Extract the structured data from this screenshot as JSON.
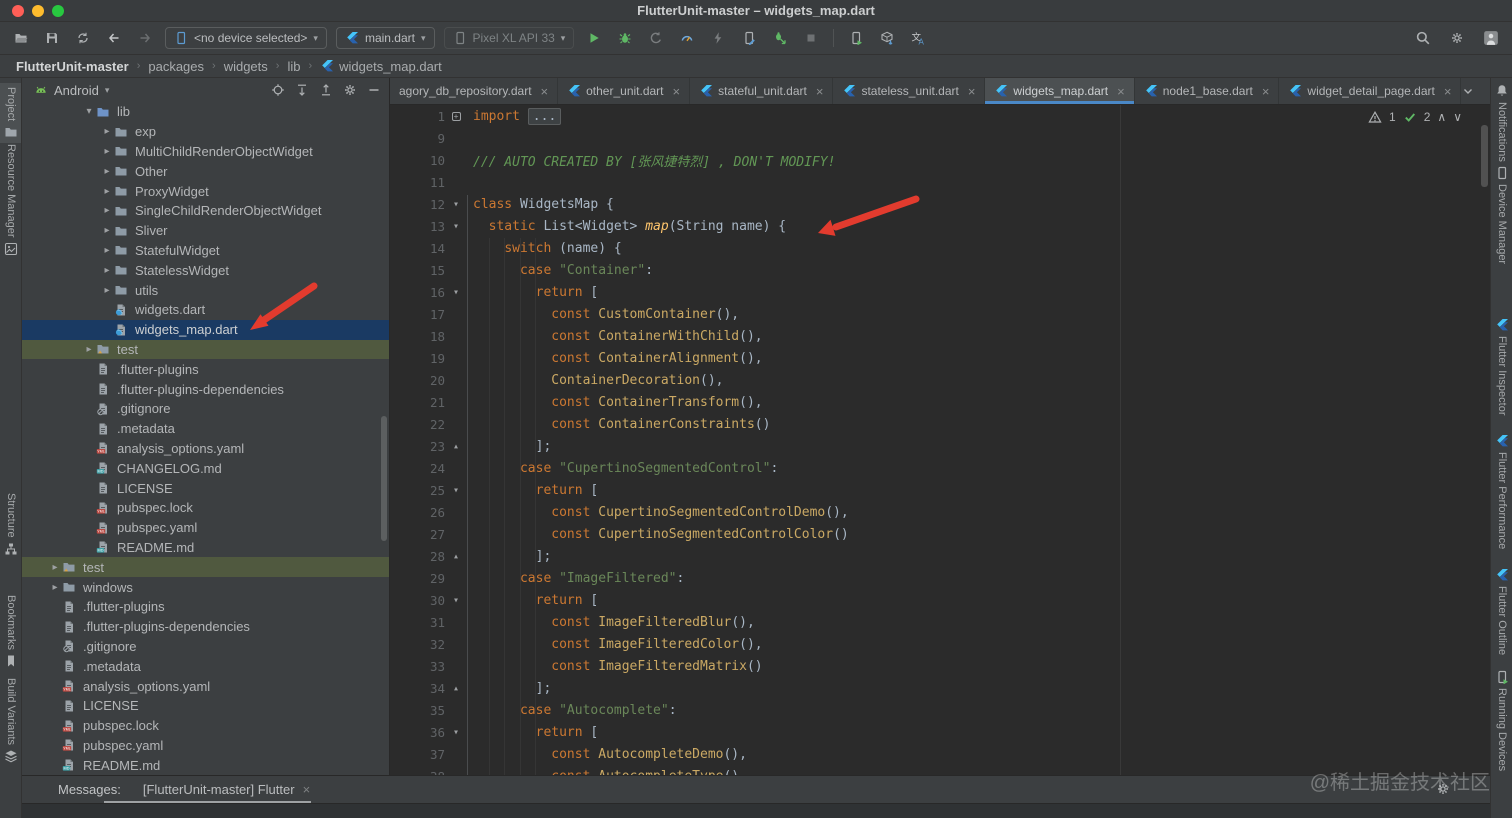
{
  "window": {
    "title": "FlutterUnit-master – widgets_map.dart"
  },
  "toolbar": {
    "device_selector": "<no device selected>",
    "run_config": "main.dart",
    "target_device": "Pixel XL API 33"
  },
  "breadcrumbs": {
    "items": [
      "FlutterUnit-master",
      "packages",
      "widgets",
      "lib",
      "widgets_map.dart"
    ]
  },
  "left_strip": {
    "items": [
      {
        "label": "Project",
        "icon": "project-folder",
        "active": true
      },
      {
        "label": "Resource Manager",
        "icon": "resource-manager",
        "active": false
      },
      {
        "label": "Structure",
        "icon": "structure",
        "active": false
      },
      {
        "label": "Bookmarks",
        "icon": "bookmarks",
        "active": false
      },
      {
        "label": "Build Variants",
        "icon": "build-variants",
        "active": false
      }
    ]
  },
  "right_strip": {
    "items": [
      {
        "label": "Notifications",
        "icon": "bell"
      },
      {
        "label": "Device Manager",
        "icon": "device"
      },
      {
        "label": "Flutter Inspector",
        "icon": "flutter"
      },
      {
        "label": "Flutter Performance",
        "icon": "flutter"
      },
      {
        "label": "Flutter Outline",
        "icon": "flutter"
      },
      {
        "label": "Running Devices",
        "icon": "device-play"
      }
    ]
  },
  "project_panel": {
    "view_mode": "Android",
    "tree": [
      {
        "label": "lib",
        "icon": "folder-lib",
        "level": 1,
        "chevron": "expanded"
      },
      {
        "label": "exp",
        "icon": "folder",
        "level": 2,
        "chevron": "collapsed"
      },
      {
        "label": "MultiChildRenderObjectWidget",
        "icon": "folder",
        "level": 2,
        "chevron": "collapsed"
      },
      {
        "label": "Other",
        "icon": "folder",
        "level": 2,
        "chevron": "collapsed"
      },
      {
        "label": "ProxyWidget",
        "icon": "folder",
        "level": 2,
        "chevron": "collapsed"
      },
      {
        "label": "SingleChildRenderObjectWidget",
        "icon": "folder",
        "level": 2,
        "chevron": "collapsed"
      },
      {
        "label": "Sliver",
        "icon": "folder",
        "level": 2,
        "chevron": "collapsed"
      },
      {
        "label": "StatefulWidget",
        "icon": "folder",
        "level": 2,
        "chevron": "collapsed"
      },
      {
        "label": "StatelessWidget",
        "icon": "folder",
        "level": 2,
        "chevron": "collapsed"
      },
      {
        "label": "utils",
        "icon": "folder",
        "level": 2,
        "chevron": "collapsed"
      },
      {
        "label": "widgets.dart",
        "icon": "dart-file",
        "level": 2,
        "chevron": "none"
      },
      {
        "label": "widgets_map.dart",
        "icon": "dart-file",
        "level": 2,
        "chevron": "none",
        "selected": true
      },
      {
        "label": "test",
        "icon": "folder-test",
        "level": 1,
        "chevron": "collapsed",
        "highlight": "green"
      },
      {
        "label": ".flutter-plugins",
        "icon": "file",
        "level": 1,
        "chevron": "none"
      },
      {
        "label": ".flutter-plugins-dependencies",
        "icon": "file",
        "level": 1,
        "chevron": "none"
      },
      {
        "label": ".gitignore",
        "icon": "git-file",
        "level": 1,
        "chevron": "none"
      },
      {
        "label": ".metadata",
        "icon": "file",
        "level": 1,
        "chevron": "none"
      },
      {
        "label": "analysis_options.yaml",
        "icon": "yaml-file",
        "level": 1,
        "chevron": "none"
      },
      {
        "label": "CHANGELOG.md",
        "icon": "md-file",
        "level": 1,
        "chevron": "none"
      },
      {
        "label": "LICENSE",
        "icon": "file",
        "level": 1,
        "chevron": "none"
      },
      {
        "label": "pubspec.lock",
        "icon": "yaml-file",
        "level": 1,
        "chevron": "none"
      },
      {
        "label": "pubspec.yaml",
        "icon": "yaml-file",
        "level": 1,
        "chevron": "none"
      },
      {
        "label": "README.md",
        "icon": "md-file",
        "level": 1,
        "chevron": "none"
      },
      {
        "label": "test",
        "icon": "folder-test",
        "level": 0,
        "chevron": "collapsed",
        "highlight": "green"
      },
      {
        "label": "windows",
        "icon": "folder",
        "level": 0,
        "chevron": "collapsed"
      },
      {
        "label": ".flutter-plugins",
        "icon": "file",
        "level": 0,
        "chevron": "none"
      },
      {
        "label": ".flutter-plugins-dependencies",
        "icon": "file",
        "level": 0,
        "chevron": "none"
      },
      {
        "label": ".gitignore",
        "icon": "git-file",
        "level": 0,
        "chevron": "none"
      },
      {
        "label": ".metadata",
        "icon": "file",
        "level": 0,
        "chevron": "none"
      },
      {
        "label": "analysis_options.yaml",
        "icon": "yaml-file",
        "level": 0,
        "chevron": "none"
      },
      {
        "label": "LICENSE",
        "icon": "file",
        "level": 0,
        "chevron": "none"
      },
      {
        "label": "pubspec.lock",
        "icon": "yaml-file",
        "level": 0,
        "chevron": "none"
      },
      {
        "label": "pubspec.yaml",
        "icon": "yaml-file",
        "level": 0,
        "chevron": "none"
      },
      {
        "label": "README.md",
        "icon": "md-file",
        "level": 0,
        "chevron": "none"
      }
    ]
  },
  "editor_tabs": [
    {
      "label": "agory_db_repository.dart",
      "icon": false,
      "active": false
    },
    {
      "label": "other_unit.dart",
      "icon": true,
      "active": false
    },
    {
      "label": "stateful_unit.dart",
      "icon": true,
      "active": false
    },
    {
      "label": "stateless_unit.dart",
      "icon": true,
      "active": false
    },
    {
      "label": "widgets_map.dart",
      "icon": true,
      "active": true
    },
    {
      "label": "node1_base.dart",
      "icon": true,
      "active": false
    },
    {
      "label": "widget_detail_page.dart",
      "icon": true,
      "active": false
    }
  ],
  "editor": {
    "inspections": {
      "warnings": "1",
      "checks": "2"
    },
    "lines": [
      {
        "n": "1",
        "f": "folded",
        "t": [
          [
            "import",
            "kw"
          ],
          [
            " ",
            "pln"
          ],
          [
            "...",
            "fold"
          ]
        ]
      },
      {
        "n": "9",
        "f": null,
        "t": []
      },
      {
        "n": "10",
        "f": null,
        "t": [
          [
            "/// AUTO CREATED BY [张风捷特烈] , DON'T MODIFY!",
            "cmt"
          ]
        ]
      },
      {
        "n": "11",
        "f": null,
        "t": []
      },
      {
        "n": "12",
        "f": "start",
        "t": [
          [
            "class",
            "kw"
          ],
          [
            " WidgetsMap {",
            "pln"
          ]
        ]
      },
      {
        "n": "13",
        "f": "start",
        "t": [
          [
            "  ",
            "pln"
          ],
          [
            "static",
            "kw"
          ],
          [
            " List<Widget> ",
            "pln"
          ],
          [
            "map",
            "fn"
          ],
          [
            "(String name) {",
            "pln"
          ]
        ]
      },
      {
        "n": "14",
        "f": null,
        "t": [
          [
            "    ",
            "pln"
          ],
          [
            "switch",
            "kw"
          ],
          [
            " (name) {",
            "pln"
          ]
        ]
      },
      {
        "n": "15",
        "f": null,
        "t": [
          [
            "      ",
            "pln"
          ],
          [
            "case",
            "kw"
          ],
          [
            " ",
            "pln"
          ],
          [
            "\"Container\"",
            "str"
          ],
          [
            ":",
            "pln"
          ]
        ]
      },
      {
        "n": "16",
        "f": "start",
        "t": [
          [
            "        ",
            "pln"
          ],
          [
            "return",
            "kw"
          ],
          [
            " [",
            "pln"
          ]
        ]
      },
      {
        "n": "17",
        "f": null,
        "t": [
          [
            "          ",
            "pln"
          ],
          [
            "const",
            "kw"
          ],
          [
            " ",
            "pln"
          ],
          [
            "CustomContainer",
            "cls"
          ],
          [
            "(),",
            "pln"
          ]
        ]
      },
      {
        "n": "18",
        "f": null,
        "t": [
          [
            "          ",
            "pln"
          ],
          [
            "const",
            "kw"
          ],
          [
            " ",
            "pln"
          ],
          [
            "ContainerWithChild",
            "cls"
          ],
          [
            "(),",
            "pln"
          ]
        ]
      },
      {
        "n": "19",
        "f": null,
        "t": [
          [
            "          ",
            "pln"
          ],
          [
            "const",
            "kw"
          ],
          [
            " ",
            "pln"
          ],
          [
            "ContainerAlignment",
            "cls"
          ],
          [
            "(),",
            "pln"
          ]
        ]
      },
      {
        "n": "20",
        "f": null,
        "t": [
          [
            "          ",
            "pln"
          ],
          [
            "ContainerDecoration",
            "cls"
          ],
          [
            "(),",
            "pln"
          ]
        ]
      },
      {
        "n": "21",
        "f": null,
        "t": [
          [
            "          ",
            "pln"
          ],
          [
            "const",
            "kw"
          ],
          [
            " ",
            "pln"
          ],
          [
            "ContainerTransform",
            "cls"
          ],
          [
            "(),",
            "pln"
          ]
        ]
      },
      {
        "n": "22",
        "f": null,
        "t": [
          [
            "          ",
            "pln"
          ],
          [
            "const",
            "kw"
          ],
          [
            " ",
            "pln"
          ],
          [
            "ContainerConstraints",
            "cls"
          ],
          [
            "()",
            "pln"
          ]
        ]
      },
      {
        "n": "23",
        "f": "end",
        "t": [
          [
            "        ];",
            "pln"
          ]
        ]
      },
      {
        "n": "24",
        "f": null,
        "t": [
          [
            "      ",
            "pln"
          ],
          [
            "case",
            "kw"
          ],
          [
            " ",
            "pln"
          ],
          [
            "\"CupertinoSegmentedControl\"",
            "str"
          ],
          [
            ":",
            "pln"
          ]
        ]
      },
      {
        "n": "25",
        "f": "start",
        "t": [
          [
            "        ",
            "pln"
          ],
          [
            "return",
            "kw"
          ],
          [
            " [",
            "pln"
          ]
        ]
      },
      {
        "n": "26",
        "f": null,
        "t": [
          [
            "          ",
            "pln"
          ],
          [
            "const",
            "kw"
          ],
          [
            " ",
            "pln"
          ],
          [
            "CupertinoSegmentedControlDemo",
            "cls"
          ],
          [
            "(),",
            "pln"
          ]
        ]
      },
      {
        "n": "27",
        "f": null,
        "t": [
          [
            "          ",
            "pln"
          ],
          [
            "const",
            "kw"
          ],
          [
            " ",
            "pln"
          ],
          [
            "CupertinoSegmentedControlColor",
            "cls"
          ],
          [
            "()",
            "pln"
          ]
        ]
      },
      {
        "n": "28",
        "f": "end",
        "t": [
          [
            "        ];",
            "pln"
          ]
        ]
      },
      {
        "n": "29",
        "f": null,
        "t": [
          [
            "      ",
            "pln"
          ],
          [
            "case",
            "kw"
          ],
          [
            " ",
            "pln"
          ],
          [
            "\"ImageFiltered\"",
            "str"
          ],
          [
            ":",
            "pln"
          ]
        ]
      },
      {
        "n": "30",
        "f": "start",
        "t": [
          [
            "        ",
            "pln"
          ],
          [
            "return",
            "kw"
          ],
          [
            " [",
            "pln"
          ]
        ]
      },
      {
        "n": "31",
        "f": null,
        "t": [
          [
            "          ",
            "pln"
          ],
          [
            "const",
            "kw"
          ],
          [
            " ",
            "pln"
          ],
          [
            "ImageFilteredBlur",
            "cls"
          ],
          [
            "(),",
            "pln"
          ]
        ]
      },
      {
        "n": "32",
        "f": null,
        "t": [
          [
            "          ",
            "pln"
          ],
          [
            "const",
            "kw"
          ],
          [
            " ",
            "pln"
          ],
          [
            "ImageFilteredColor",
            "cls"
          ],
          [
            "(),",
            "pln"
          ]
        ]
      },
      {
        "n": "33",
        "f": null,
        "t": [
          [
            "          ",
            "pln"
          ],
          [
            "const",
            "kw"
          ],
          [
            " ",
            "pln"
          ],
          [
            "ImageFilteredMatrix",
            "cls"
          ],
          [
            "()",
            "pln"
          ]
        ]
      },
      {
        "n": "34",
        "f": "end",
        "t": [
          [
            "        ];",
            "pln"
          ]
        ]
      },
      {
        "n": "35",
        "f": null,
        "t": [
          [
            "      ",
            "pln"
          ],
          [
            "case",
            "kw"
          ],
          [
            " ",
            "pln"
          ],
          [
            "\"Autocomplete\"",
            "str"
          ],
          [
            ":",
            "pln"
          ]
        ]
      },
      {
        "n": "36",
        "f": "start",
        "t": [
          [
            "        ",
            "pln"
          ],
          [
            "return",
            "kw"
          ],
          [
            " [",
            "pln"
          ]
        ]
      },
      {
        "n": "37",
        "f": null,
        "t": [
          [
            "          ",
            "pln"
          ],
          [
            "const",
            "kw"
          ],
          [
            " ",
            "pln"
          ],
          [
            "AutocompleteDemo",
            "cls"
          ],
          [
            "(),",
            "pln"
          ]
        ]
      },
      {
        "n": "38",
        "f": null,
        "t": [
          [
            "          ",
            "pln"
          ],
          [
            "const",
            "kw"
          ],
          [
            " ",
            "pln"
          ],
          [
            "AutocompleteType",
            "cls"
          ],
          [
            "()",
            "pln"
          ]
        ]
      }
    ]
  },
  "messages_bar": {
    "label": "Messages:",
    "tab": "[FlutterUnit-master] Flutter"
  },
  "watermark": "@稀土掘金技术社区",
  "colors": {
    "accent_blue": "#4A88C7",
    "run_green": "#5FB865",
    "arrow_red": "#E23B2E",
    "keyword": "#CC7832",
    "string": "#6A8759",
    "comment": "#629755",
    "class_ref": "#CBA964",
    "function": "#FFC66D",
    "plain": "#A9B7C6",
    "editor_bg": "#2B2B2B",
    "chrome_bg": "#3C3F41",
    "selection_row": "#1A3A63",
    "test_row": "#50593F"
  }
}
